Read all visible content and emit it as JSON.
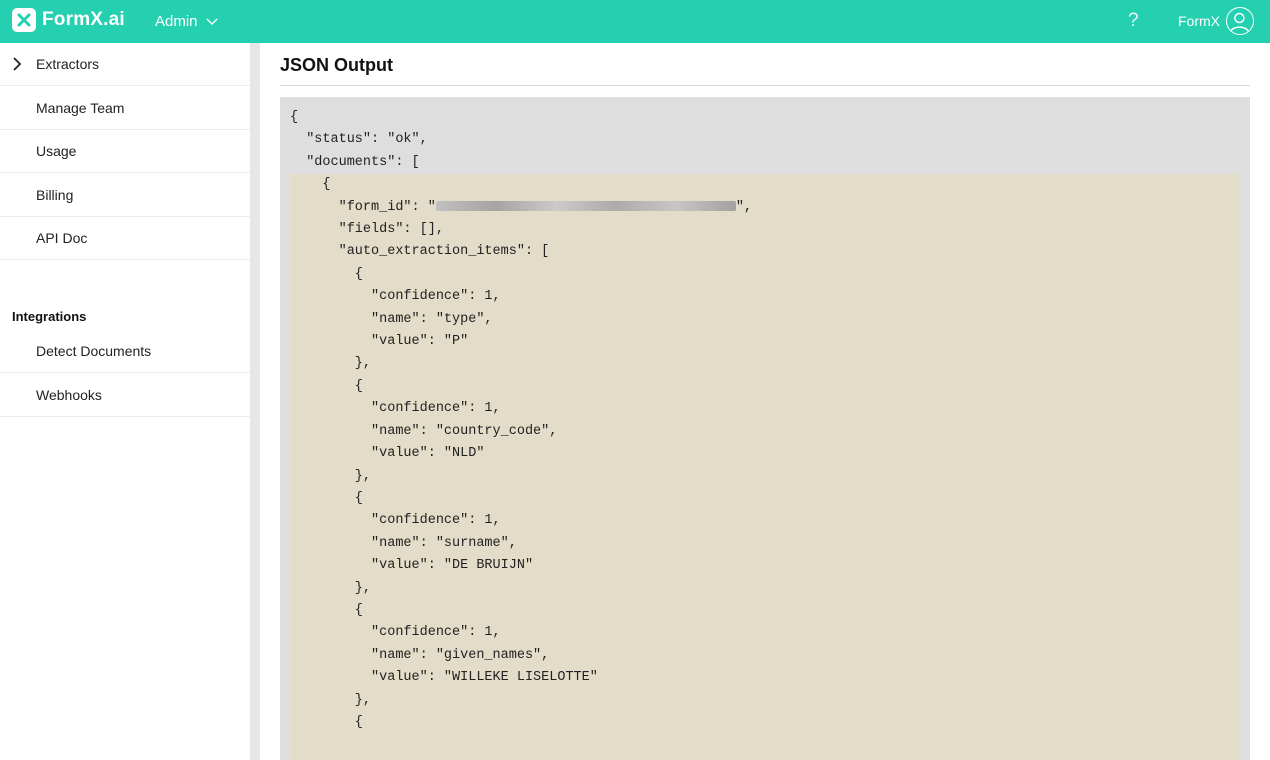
{
  "header": {
    "logo_text": "FormX.ai",
    "admin_label": "Admin",
    "help_label": "?",
    "account_name": "FormX"
  },
  "sidebar": {
    "items": [
      {
        "label": "Extractors"
      },
      {
        "label": "Manage Team"
      },
      {
        "label": "Usage"
      },
      {
        "label": "Billing"
      },
      {
        "label": "API Doc"
      }
    ],
    "section_title": "Integrations",
    "integration_items": [
      {
        "label": "Detect Documents"
      },
      {
        "label": "Webhooks"
      }
    ]
  },
  "main": {
    "title": "JSON Output",
    "code_lines": [
      "{",
      "  \"status\": \"ok\",",
      "  \"documents\": [",
      "    {",
      "      \"form_id\": \"",
      "\",",
      "      \"fields\": [],",
      "      \"auto_extraction_items\": [",
      "        {",
      "          \"confidence\": 1,",
      "          \"name\": \"type\",",
      "          \"value\": \"P\"",
      "        },",
      "        {",
      "          \"confidence\": 1,",
      "          \"name\": \"country_code\",",
      "          \"value\": \"NLD\"",
      "        },",
      "        {",
      "          \"confidence\": 1,",
      "          \"name\": \"surname\",",
      "          \"value\": \"DE BRUIJN\"",
      "        },",
      "        {",
      "          \"confidence\": 1,",
      "          \"name\": \"given_names\",",
      "          \"value\": \"WILLEKE LISELOTTE\"",
      "        },",
      "        {",
      "          \"confidence\": 1,"
    ]
  },
  "colors": {
    "brand": "#25d0b0",
    "code_bg": "#dedede",
    "code_highlight": "#e2dcc8"
  }
}
